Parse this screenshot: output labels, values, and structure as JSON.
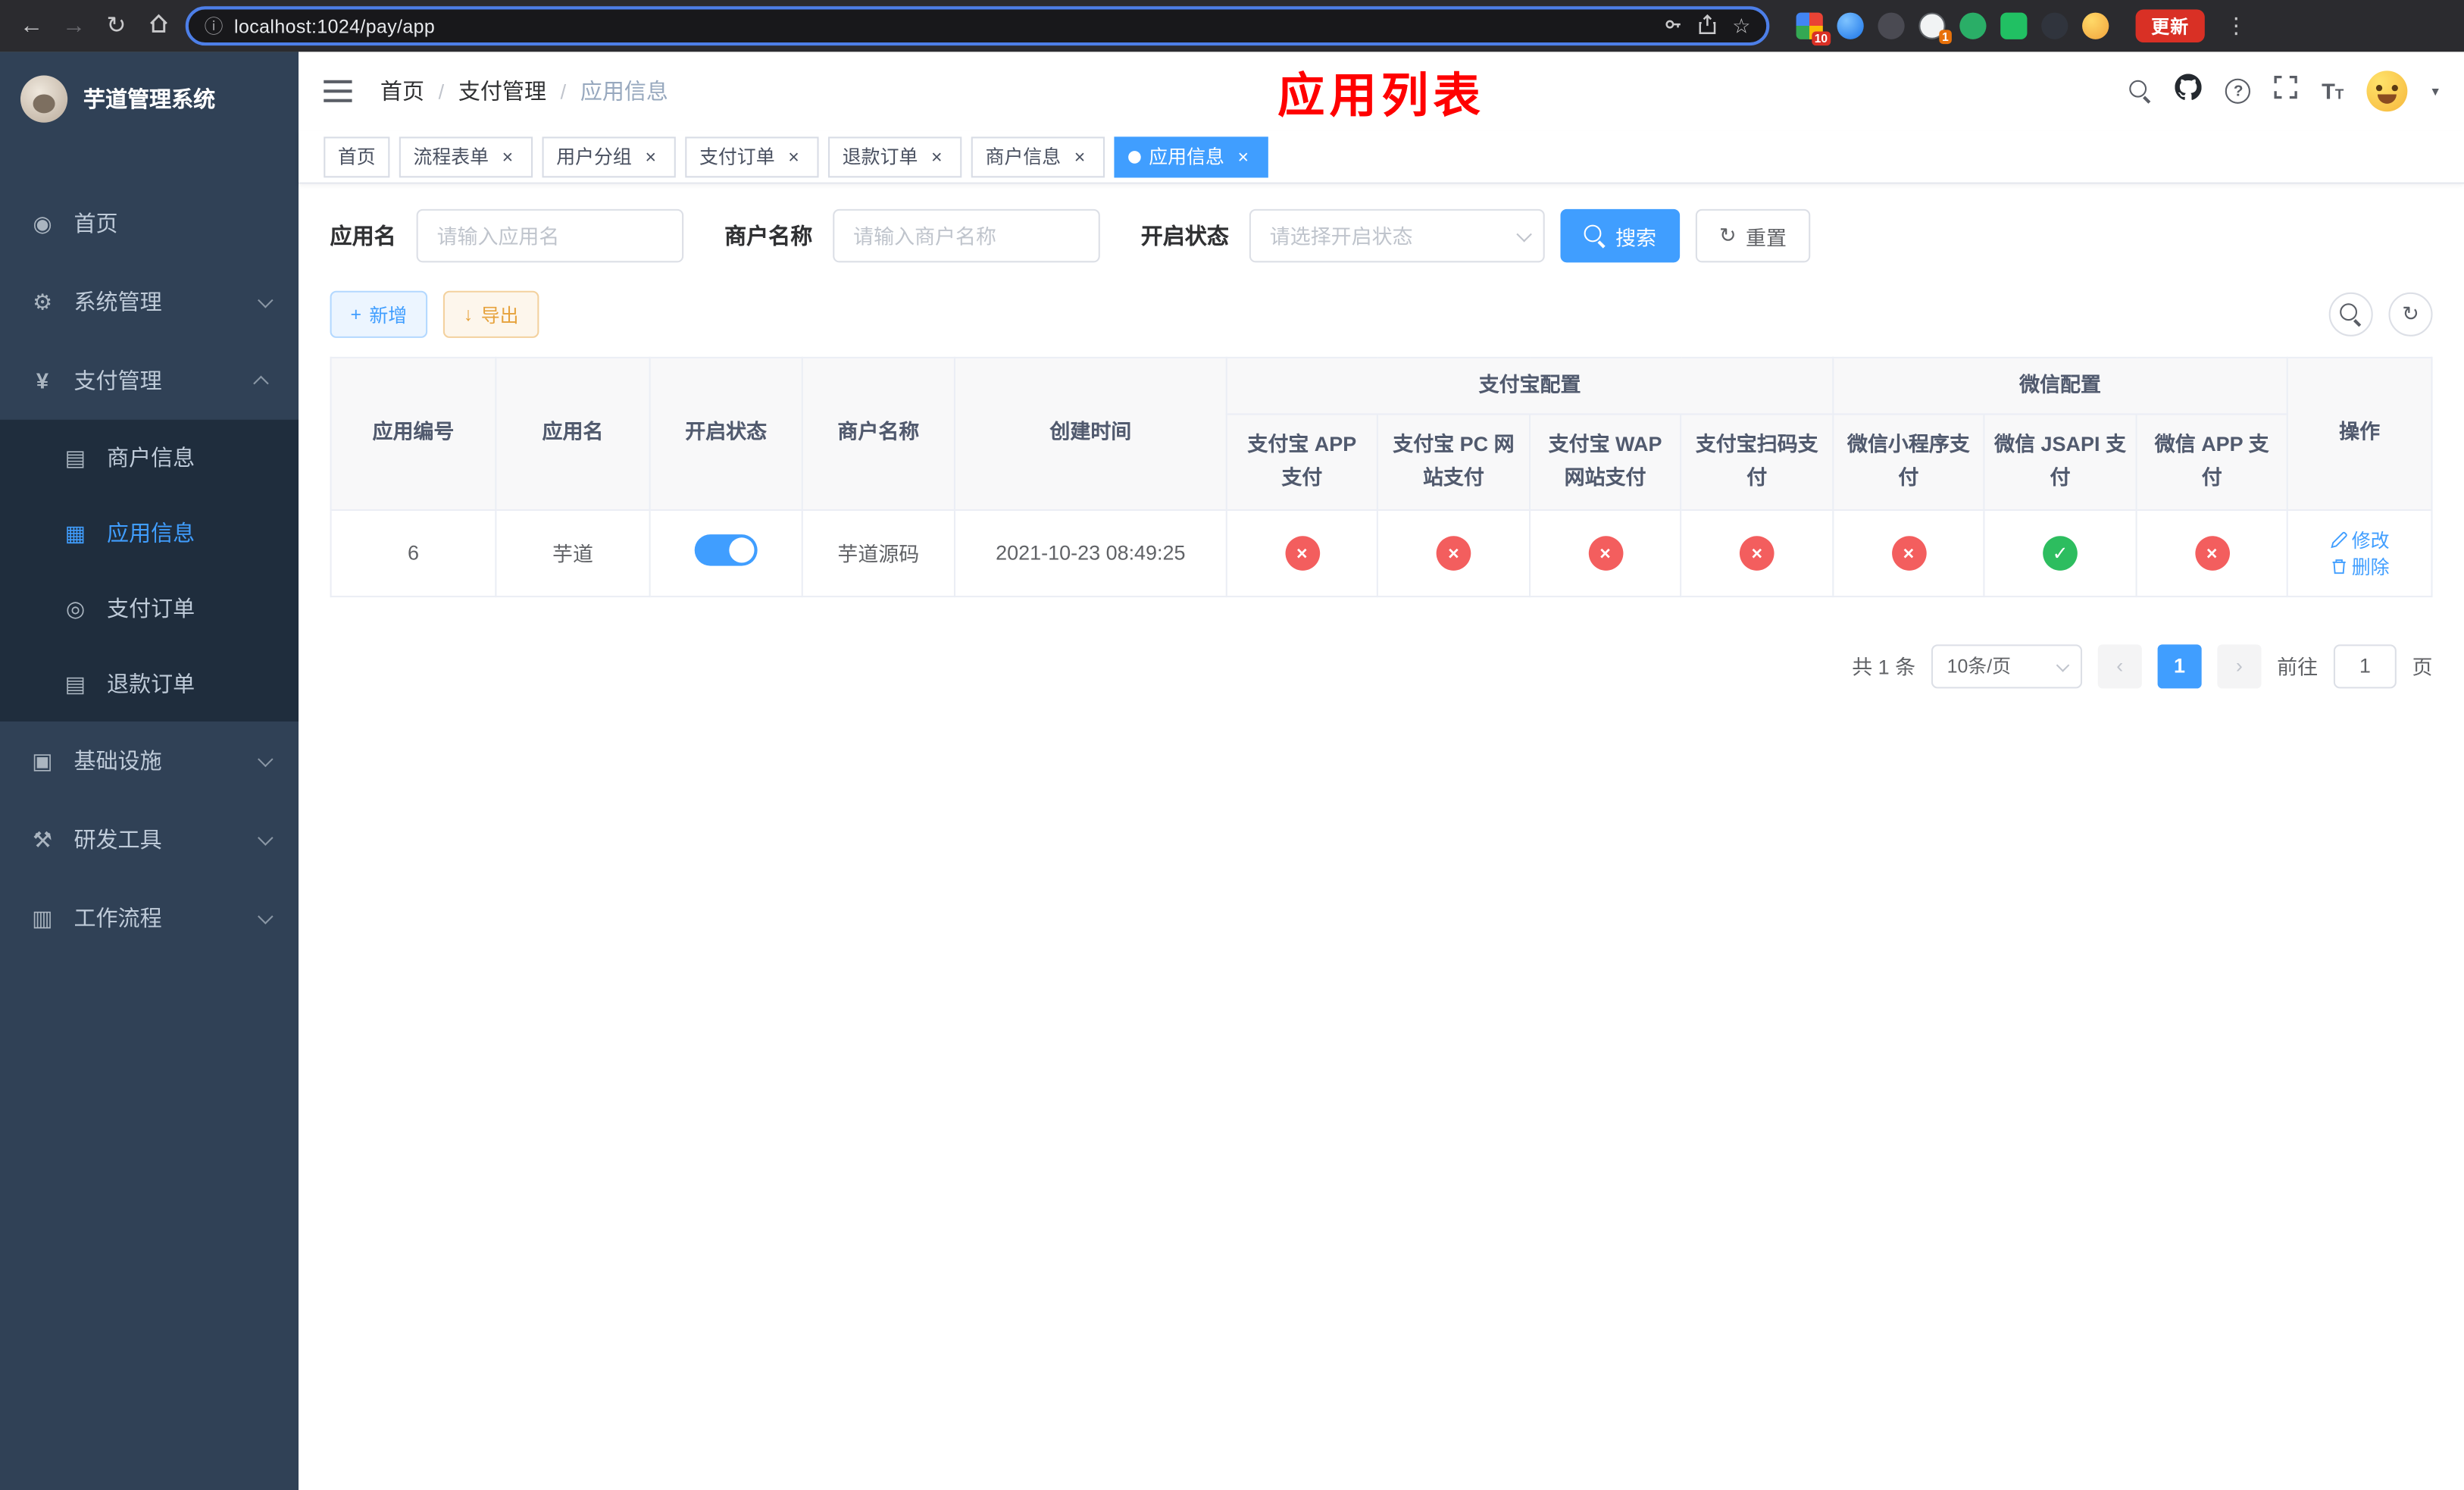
{
  "browser": {
    "url": "localhost:1024/pay/app",
    "update_label": "更新",
    "ext_badge_1": "10",
    "ext_badge_2": "1"
  },
  "sidebar": {
    "title": "芋道管理系统",
    "items": [
      {
        "label": "首页"
      },
      {
        "label": "系统管理"
      },
      {
        "label": "支付管理"
      }
    ],
    "submenu": [
      {
        "label": "商户信息"
      },
      {
        "label": "应用信息"
      },
      {
        "label": "支付订单"
      },
      {
        "label": "退款订单"
      }
    ],
    "items2": [
      {
        "label": "基础设施"
      },
      {
        "label": "研发工具"
      },
      {
        "label": "工作流程"
      }
    ]
  },
  "topbar": {
    "breadcrumb": [
      "首页",
      "支付管理",
      "应用信息"
    ],
    "title": "应用列表"
  },
  "tabs": [
    {
      "label": "首页"
    },
    {
      "label": "流程表单"
    },
    {
      "label": "用户分组"
    },
    {
      "label": "支付订单"
    },
    {
      "label": "退款订单"
    },
    {
      "label": "商户信息"
    },
    {
      "label": "应用信息"
    }
  ],
  "filters": {
    "app_name_label": "应用名",
    "app_name_placeholder": "请输入应用名",
    "merchant_label": "商户名称",
    "merchant_placeholder": "请输入商户名称",
    "status_label": "开启状态",
    "status_placeholder": "请选择开启状态",
    "search_label": "搜索",
    "reset_label": "重置"
  },
  "toolbar": {
    "add_label": "新增",
    "export_label": "导出"
  },
  "table": {
    "columns": {
      "id": "应用编号",
      "name": "应用名",
      "status": "开启状态",
      "merchant": "商户名称",
      "created": "创建时间",
      "actions": "操作"
    },
    "groups": {
      "alipay": "支付宝配置",
      "wechat": "微信配置"
    },
    "sub_headers": [
      "支付宝 APP 支付",
      "支付宝 PC 网站支付",
      "支付宝 WAP 网站支付",
      "支付宝扫码支付",
      "微信小程序支付",
      "微信 JSAPI 支付",
      "微信 APP 支付"
    ],
    "row": {
      "id": "6",
      "name": "芋道",
      "merchant": "芋道源码",
      "created": "2021-10-23 08:49:25",
      "statuses": [
        "x",
        "x",
        "x",
        "x",
        "x",
        "check",
        "x"
      ],
      "edit_label": "修改",
      "delete_label": "删除"
    }
  },
  "pagination": {
    "total": "共 1 条",
    "page_size": "10条/页",
    "current_page": "1",
    "goto_label": "前往",
    "goto_value": "1",
    "unit_label": "页"
  },
  "colors": {
    "accent": "#409eff",
    "danger": "#f35e5e",
    "success": "#2dbd5f",
    "warning": "#e6a23c",
    "title_red": "#ff0000"
  }
}
